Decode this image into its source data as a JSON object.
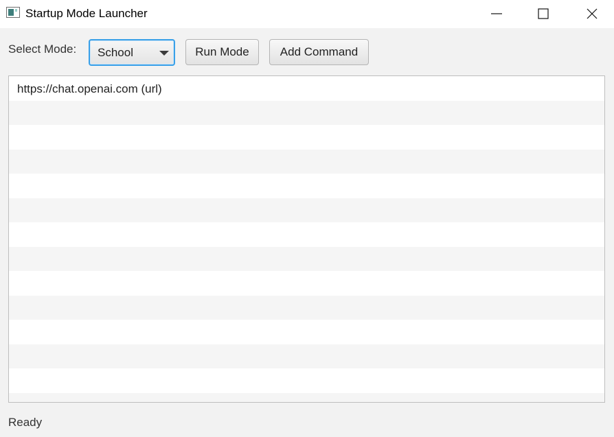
{
  "window": {
    "title": "Startup Mode Launcher",
    "icon": "java-app-icon",
    "controls": [
      "minimize-icon",
      "maximize-icon",
      "close-icon"
    ]
  },
  "toolbar": {
    "select_label": "Select Mode:",
    "mode_selected": "School",
    "run_label": "Run Mode",
    "add_label": "Add Command"
  },
  "commands": {
    "items": [
      {
        "label": "https://chat.openai.com (url)"
      }
    ]
  },
  "status": {
    "text": "Ready"
  },
  "colors": {
    "focus_accent": "#39a0e8",
    "alt_row": "#f5f5f5"
  }
}
